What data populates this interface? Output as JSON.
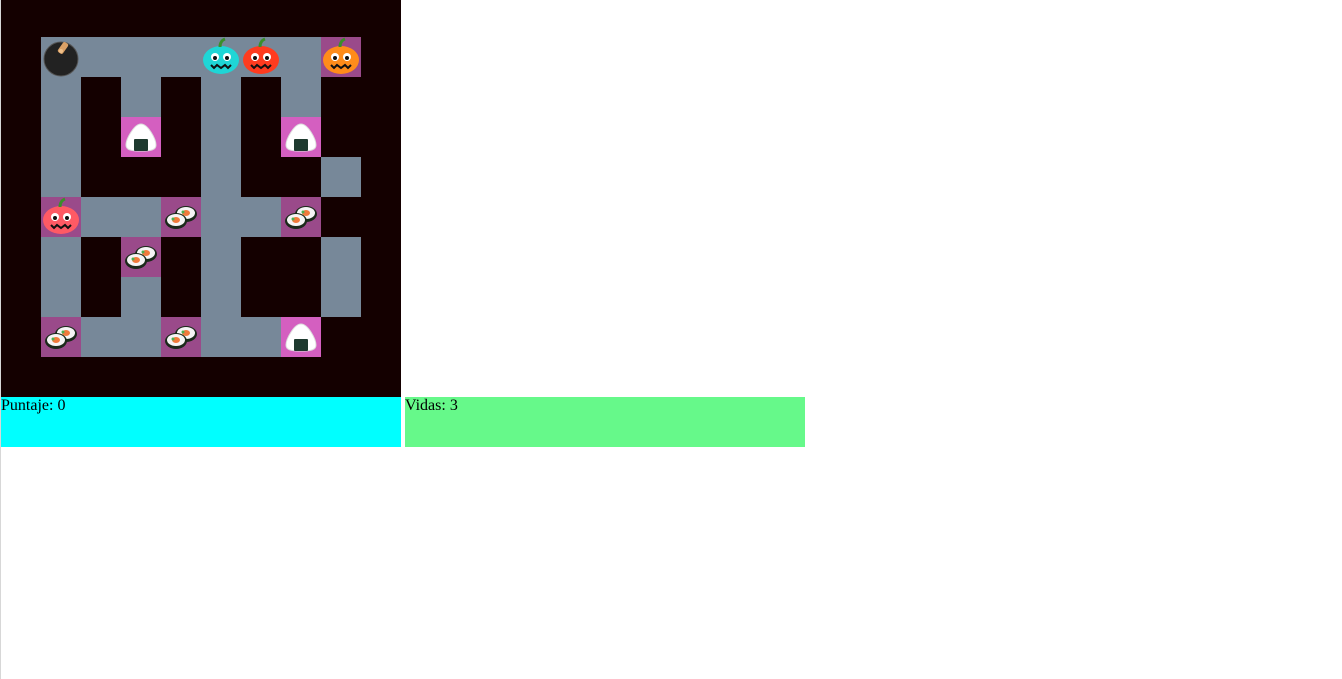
{
  "status": {
    "score_label": "Puntaje:",
    "score_value": "0",
    "lives_label": "Vidas:",
    "lives_value": "3"
  },
  "colors": {
    "wall": "#140000",
    "path": "#778899",
    "sushi_tile": "#9a4a8a",
    "onigiri_tile": "#d45fc0",
    "score_bar": "#00ffff",
    "lives_bar": "#66f98a"
  },
  "maze": {
    "legend": {
      "W": "wall",
      ".": "path",
      "P": "player-bomb",
      "S": "sushi",
      "O": "onigiri",
      "C": "ghost-cyan",
      "R": "ghost-red",
      "Y": "ghost-orange",
      "K": "ghost-pink"
    },
    "rows": [
      "WWWWWWWWWW",
      "WP...CR.YW",
      "W.W.W.W.WW",
      "W.WOW.WOWW",
      "W.WWW.WW.W",
      "WK..S..SWW",
      "W.WSW.WW.W",
      "W.W.W.WW.W",
      "WS..S..OWW",
      "WWWWWWWWWW"
    ],
    "icons": {
      "P": "bomb-icon",
      "S": "sushi-icon",
      "O": "onigiri-icon",
      "C": "pumpkin-ghost-icon",
      "R": "pumpkin-ghost-icon",
      "Y": "pumpkin-ghost-icon",
      "K": "pumpkin-ghost-icon"
    },
    "ghost_colors": {
      "C": "#1fd6d6",
      "R": "#ff3b1f",
      "Y": "#ff8c1a",
      "K": "#ff5a64"
    }
  }
}
